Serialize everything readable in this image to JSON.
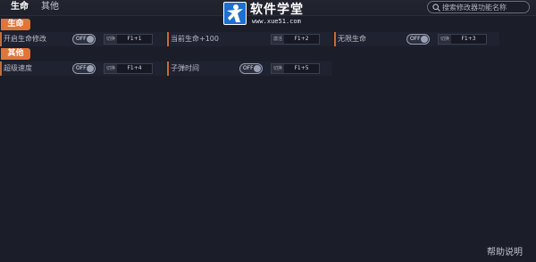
{
  "tabs": [
    {
      "label": "生命",
      "active": true
    },
    {
      "label": "其他",
      "active": false
    }
  ],
  "search": {
    "placeholder": "搜索修改器功能名称"
  },
  "logo": {
    "title": "软件学堂",
    "subtitle": "www.xue51.com"
  },
  "sections": {
    "life": {
      "label": "生命",
      "items": [
        {
          "label": "开启生命修改",
          "toggle": "OFF",
          "action": "切换",
          "keys": "F1+1"
        },
        {
          "label": "当前生命+100",
          "action": "激活",
          "keys": "F1+2"
        },
        {
          "label": "无限生命",
          "toggle": "OFF",
          "action": "切换",
          "keys": "F1+3"
        }
      ]
    },
    "other": {
      "label": "其他",
      "items": [
        {
          "label": "超级速度",
          "toggle": "OFF",
          "action": "切换",
          "keys": "F1+4"
        },
        {
          "label": "子弹时间",
          "toggle": "OFF",
          "action": "切换",
          "keys": "F1+5"
        }
      ]
    }
  },
  "footer": {
    "help": "帮助说明"
  },
  "colors": {
    "accent": "#e0743a",
    "background": "#1b1e29",
    "row": "#1f2230"
  }
}
